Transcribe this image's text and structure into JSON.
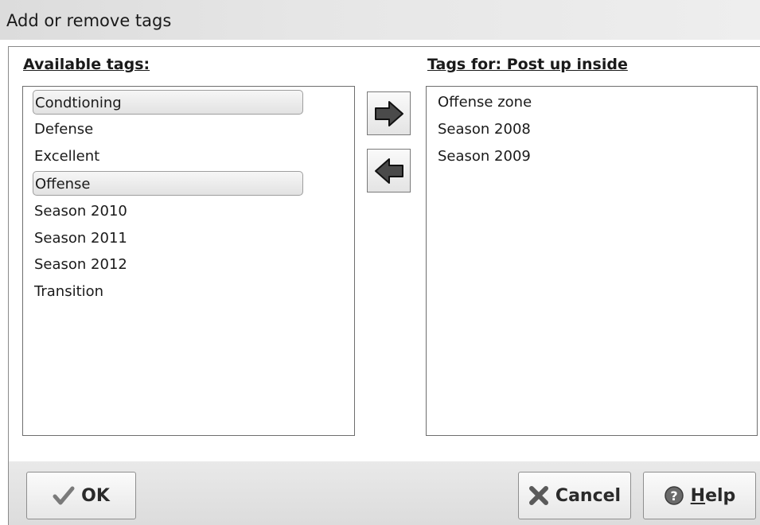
{
  "window": {
    "title": "Add or remove tags"
  },
  "available": {
    "label": "Available tags:",
    "items": [
      {
        "label": "Condtioning",
        "selected": true
      },
      {
        "label": "Defense",
        "selected": false
      },
      {
        "label": "Excellent",
        "selected": false
      },
      {
        "label": "Offense",
        "selected": true
      },
      {
        "label": "Season 2010",
        "selected": false
      },
      {
        "label": "Season 2011",
        "selected": false
      },
      {
        "label": "Season 2012",
        "selected": false
      },
      {
        "label": "Transition",
        "selected": false
      }
    ]
  },
  "assigned": {
    "label": "Tags for: Post up inside",
    "items": [
      {
        "label": "Offense zone"
      },
      {
        "label": "Season 2008"
      },
      {
        "label": "Season 2009"
      }
    ]
  },
  "buttons": {
    "ok": {
      "label": "OK",
      "icon": "check-icon"
    },
    "cancel": {
      "label": "Cancel",
      "icon": "cross-icon"
    },
    "help": {
      "label_prefix": "H",
      "label_rest": "elp",
      "icon": "help-icon"
    }
  },
  "arrows": {
    "add_icon": "arrow-right-icon",
    "remove_icon": "arrow-left-icon"
  }
}
